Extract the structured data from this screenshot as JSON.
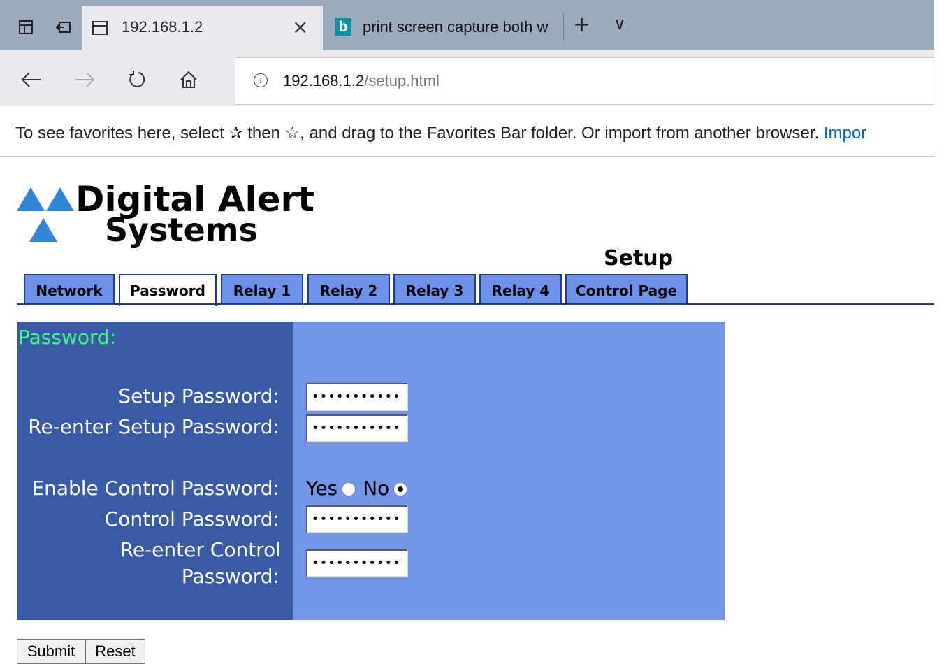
{
  "browser": {
    "active_tab_title": "192.168.1.2",
    "inactive_tab_title": "print screen capture both w",
    "inactive_tab_icon": "bing-icon",
    "close_glyph": "×",
    "new_tab_glyph": "+",
    "tab_menu_glyph": "∨",
    "address_host": "192.168.1.2",
    "address_path": "/setup.html",
    "favorites_message": "To see favorites here, select ✰ then ☆, and drag to the Favorites Bar folder. Or import from another browser.",
    "favorites_import_link": "Impor"
  },
  "page": {
    "logo_line1": "Digital Alert",
    "logo_line2": "Systems",
    "heading": "Setup",
    "tabs": [
      {
        "label": "Network",
        "active": false
      },
      {
        "label": "Password",
        "active": true
      },
      {
        "label": "Relay 1",
        "active": false
      },
      {
        "label": "Relay 2",
        "active": false
      },
      {
        "label": "Relay 3",
        "active": false
      },
      {
        "label": "Relay 4",
        "active": false
      },
      {
        "label": "Control Page",
        "active": false
      }
    ],
    "section_label": "Password:",
    "fields": {
      "setup_password_label": "Setup Password:",
      "setup_password_value": "•••••••••••",
      "reenter_setup_password_label": "Re-enter Setup Password:",
      "reenter_setup_password_value": "•••••••••••",
      "enable_control_label": "Enable Control Password:",
      "enable_yes_label": "Yes",
      "enable_no_label": "No",
      "enable_selected": "No",
      "control_password_label": "Control Password:",
      "control_password_value": "•••••••••••",
      "reenter_control_label_1": "Re-enter Control",
      "reenter_control_label_2": "Password:",
      "reenter_control_value": "•••••••••••"
    },
    "buttons": {
      "submit": "Submit",
      "reset": "Reset"
    },
    "colors": {
      "label_panel": "#3a5aa5",
      "field_panel": "#7395ea",
      "tab_bg": "#6f90e8",
      "section_label": "#38ff7f",
      "logo_blue": "#2f86d6"
    }
  }
}
